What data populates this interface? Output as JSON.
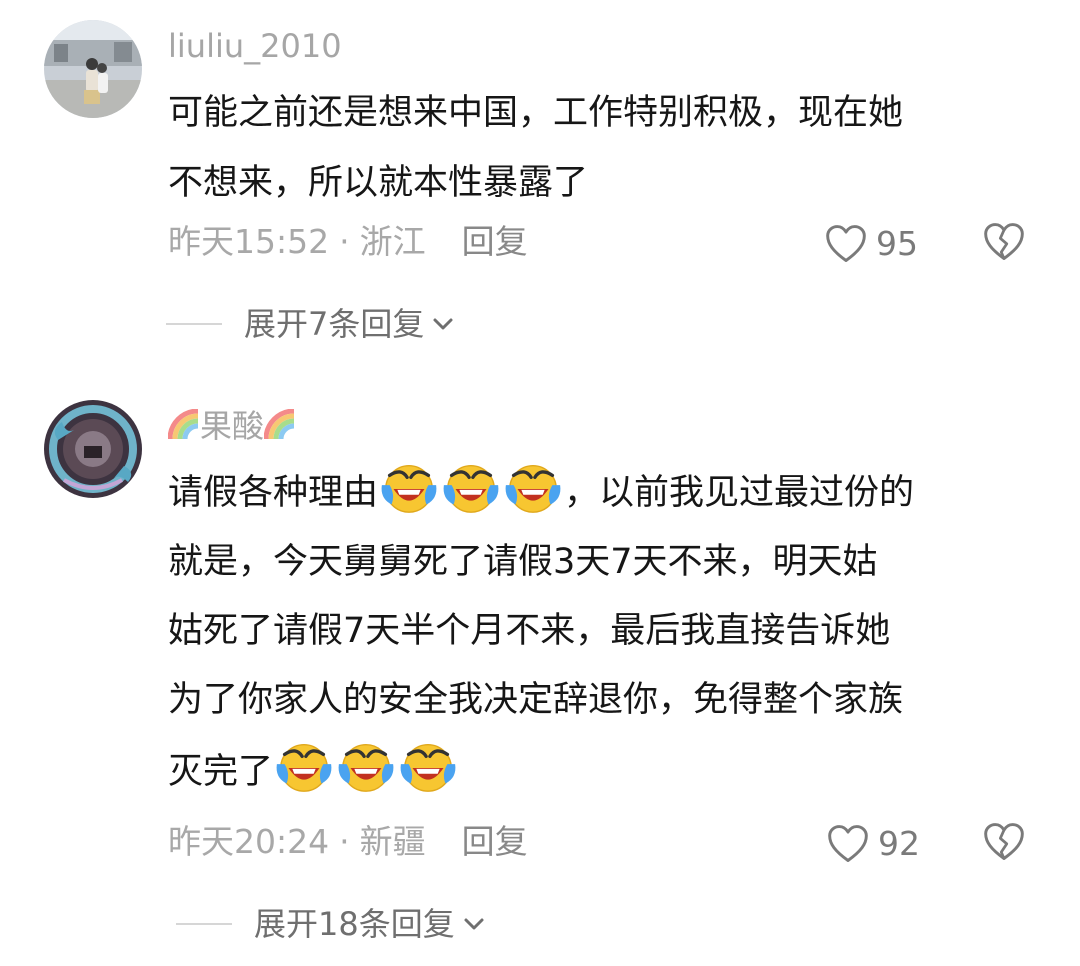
{
  "comments": [
    {
      "username": "liuliu_2010",
      "text_lines": [
        "可能之前还是想来中国，工作特别积极，现在她",
        "不想来，所以就本性暴露了"
      ],
      "time": "昨天15:52",
      "location": "浙江",
      "reply_label": "回复",
      "likes": "95",
      "expand_label": "展开7条回复",
      "avatar_icon": "photo-avatar"
    },
    {
      "username": "果酸",
      "username_decoration_icon": "rainbow-icon",
      "text_line_1_before_emoji": "请假各种理由",
      "text_line_1_after_emoji": "，以前我见过最过份的",
      "text_line_2": "就是，今天舅舅死了请假3天7天不来，明天姑",
      "text_line_3": "姑死了请假7天半个月不来，最后我直接告诉她",
      "text_line_4": "为了你家人的安全我决定辞退你，免得整个家族",
      "text_line_5_before_emoji": "灭完了",
      "emoji_icon": "loudly-crying-laughing-emoji",
      "time": "昨天20:24",
      "location": "新疆",
      "reply_label": "回复",
      "likes": "92",
      "expand_label": "展开18条回复",
      "avatar_icon": "dragon-art-avatar"
    }
  ],
  "separator": "·",
  "colors": {
    "text": "#161616",
    "muted": "#a8a8a8",
    "expand": "#6f6f6f",
    "emoji_face": "#f7c631",
    "emoji_tear": "#4aa3f0"
  }
}
